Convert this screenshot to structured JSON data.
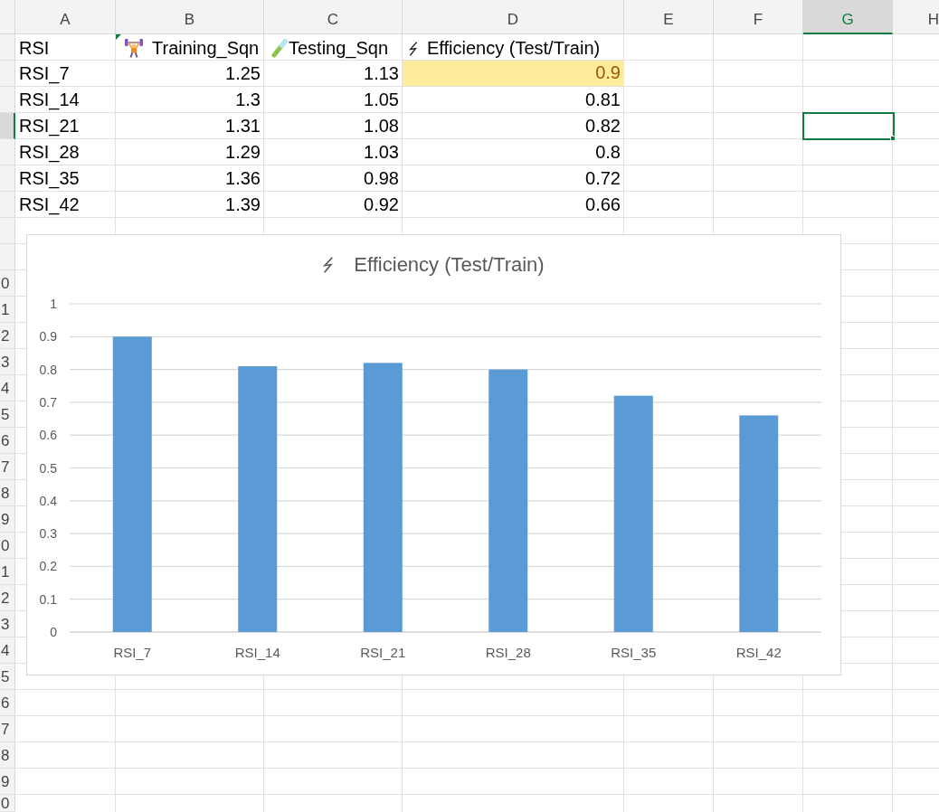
{
  "column_headers": [
    {
      "label": "A",
      "selected": false
    },
    {
      "label": "B",
      "selected": false
    },
    {
      "label": "C",
      "selected": false
    },
    {
      "label": "D",
      "selected": false
    },
    {
      "label": "E",
      "selected": false
    },
    {
      "label": "F",
      "selected": false
    },
    {
      "label": "G",
      "selected": true
    },
    {
      "label": "H",
      "selected": false
    }
  ],
  "rows": [
    {
      "selected": false,
      "cells": [
        {
          "kind": "header",
          "text": "RSI"
        },
        {
          "kind": "header",
          "text": "Training_Sqn"
        },
        {
          "kind": "header",
          "text": "Testing_Sqn"
        },
        {
          "kind": "header",
          "text": "Efficiency (Test/Train)"
        }
      ]
    },
    {
      "selected": false,
      "cells": [
        {
          "kind": "text",
          "text": "RSI_7",
          "highlighted": false
        },
        {
          "kind": "number",
          "text": "1.25",
          "highlighted": false
        },
        {
          "kind": "number",
          "text": "1.13",
          "highlighted": false
        },
        {
          "kind": "number",
          "text": "0.9",
          "highlighted": true
        }
      ]
    },
    {
      "selected": false,
      "cells": [
        {
          "kind": "text",
          "text": "RSI_14",
          "highlighted": false
        },
        {
          "kind": "number",
          "text": "1.3",
          "highlighted": false
        },
        {
          "kind": "number",
          "text": "1.05",
          "highlighted": false
        },
        {
          "kind": "number",
          "text": "0.81",
          "highlighted": false
        }
      ]
    },
    {
      "selected": true,
      "cells": [
        {
          "kind": "text",
          "text": "RSI_21",
          "highlighted": false
        },
        {
          "kind": "number",
          "text": "1.31",
          "highlighted": false
        },
        {
          "kind": "number",
          "text": "1.08",
          "highlighted": false
        },
        {
          "kind": "number",
          "text": "0.82",
          "highlighted": false
        }
      ]
    },
    {
      "selected": false,
      "cells": [
        {
          "kind": "text",
          "text": "RSI_28",
          "highlighted": false
        },
        {
          "kind": "number",
          "text": "1.29",
          "highlighted": false
        },
        {
          "kind": "number",
          "text": "1.03",
          "highlighted": false
        },
        {
          "kind": "number",
          "text": "0.8",
          "highlighted": false
        }
      ]
    },
    {
      "selected": false,
      "cells": [
        {
          "kind": "text",
          "text": "RSI_35",
          "highlighted": false
        },
        {
          "kind": "number",
          "text": "1.36",
          "highlighted": false
        },
        {
          "kind": "number",
          "text": "0.98",
          "highlighted": false
        },
        {
          "kind": "number",
          "text": "0.72",
          "highlighted": false
        }
      ]
    },
    {
      "selected": false,
      "cells": [
        {
          "kind": "text",
          "text": "RSI_42",
          "highlighted": false
        },
        {
          "kind": "number",
          "text": "1.39",
          "highlighted": false
        },
        {
          "kind": "number",
          "text": "0.92",
          "highlighted": false
        },
        {
          "kind": "number",
          "text": "0.66",
          "highlighted": false
        }
      ]
    },
    {
      "selected": false
    },
    {
      "selected": false
    },
    {
      "number": "0",
      "selected": false
    },
    {
      "number": "1",
      "selected": false
    },
    {
      "number": "2",
      "selected": false
    },
    {
      "number": "3",
      "selected": false
    },
    {
      "number": "4",
      "selected": false
    },
    {
      "number": "5",
      "selected": false
    },
    {
      "number": "6",
      "selected": false
    },
    {
      "number": "7",
      "selected": false
    },
    {
      "number": "8",
      "selected": false
    },
    {
      "number": "9",
      "selected": false
    },
    {
      "number": "0",
      "selected": false
    },
    {
      "number": "1",
      "selected": false
    },
    {
      "number": "2",
      "selected": false
    },
    {
      "number": "3",
      "selected": false
    },
    {
      "number": "4",
      "selected": false
    },
    {
      "number": "5",
      "selected": false
    },
    {
      "number": "6",
      "selected": false
    },
    {
      "number": "7",
      "selected": false
    },
    {
      "number": "8",
      "selected": false
    },
    {
      "number": "9",
      "selected": false
    },
    {
      "number": "0",
      "selected": false
    }
  ],
  "chart": {
    "chart_data": {
      "type": "bar",
      "title": "Efficiency (Test/Train)",
      "categories": [
        "RSI_7",
        "RSI_14",
        "RSI_21",
        "RSI_28",
        "RSI_35",
        "RSI_42"
      ],
      "series": [
        {
          "color": "#5b9bd5",
          "values": [
            0.9,
            0.81,
            0.82,
            0.8,
            0.72,
            0.66
          ]
        }
      ],
      "ylim": [
        0,
        1
      ],
      "yticks": [
        0,
        0.1,
        0.2,
        0.3,
        0.4,
        0.5,
        0.6,
        0.7,
        0.8,
        0.9,
        1
      ],
      "grid": true
    }
  }
}
